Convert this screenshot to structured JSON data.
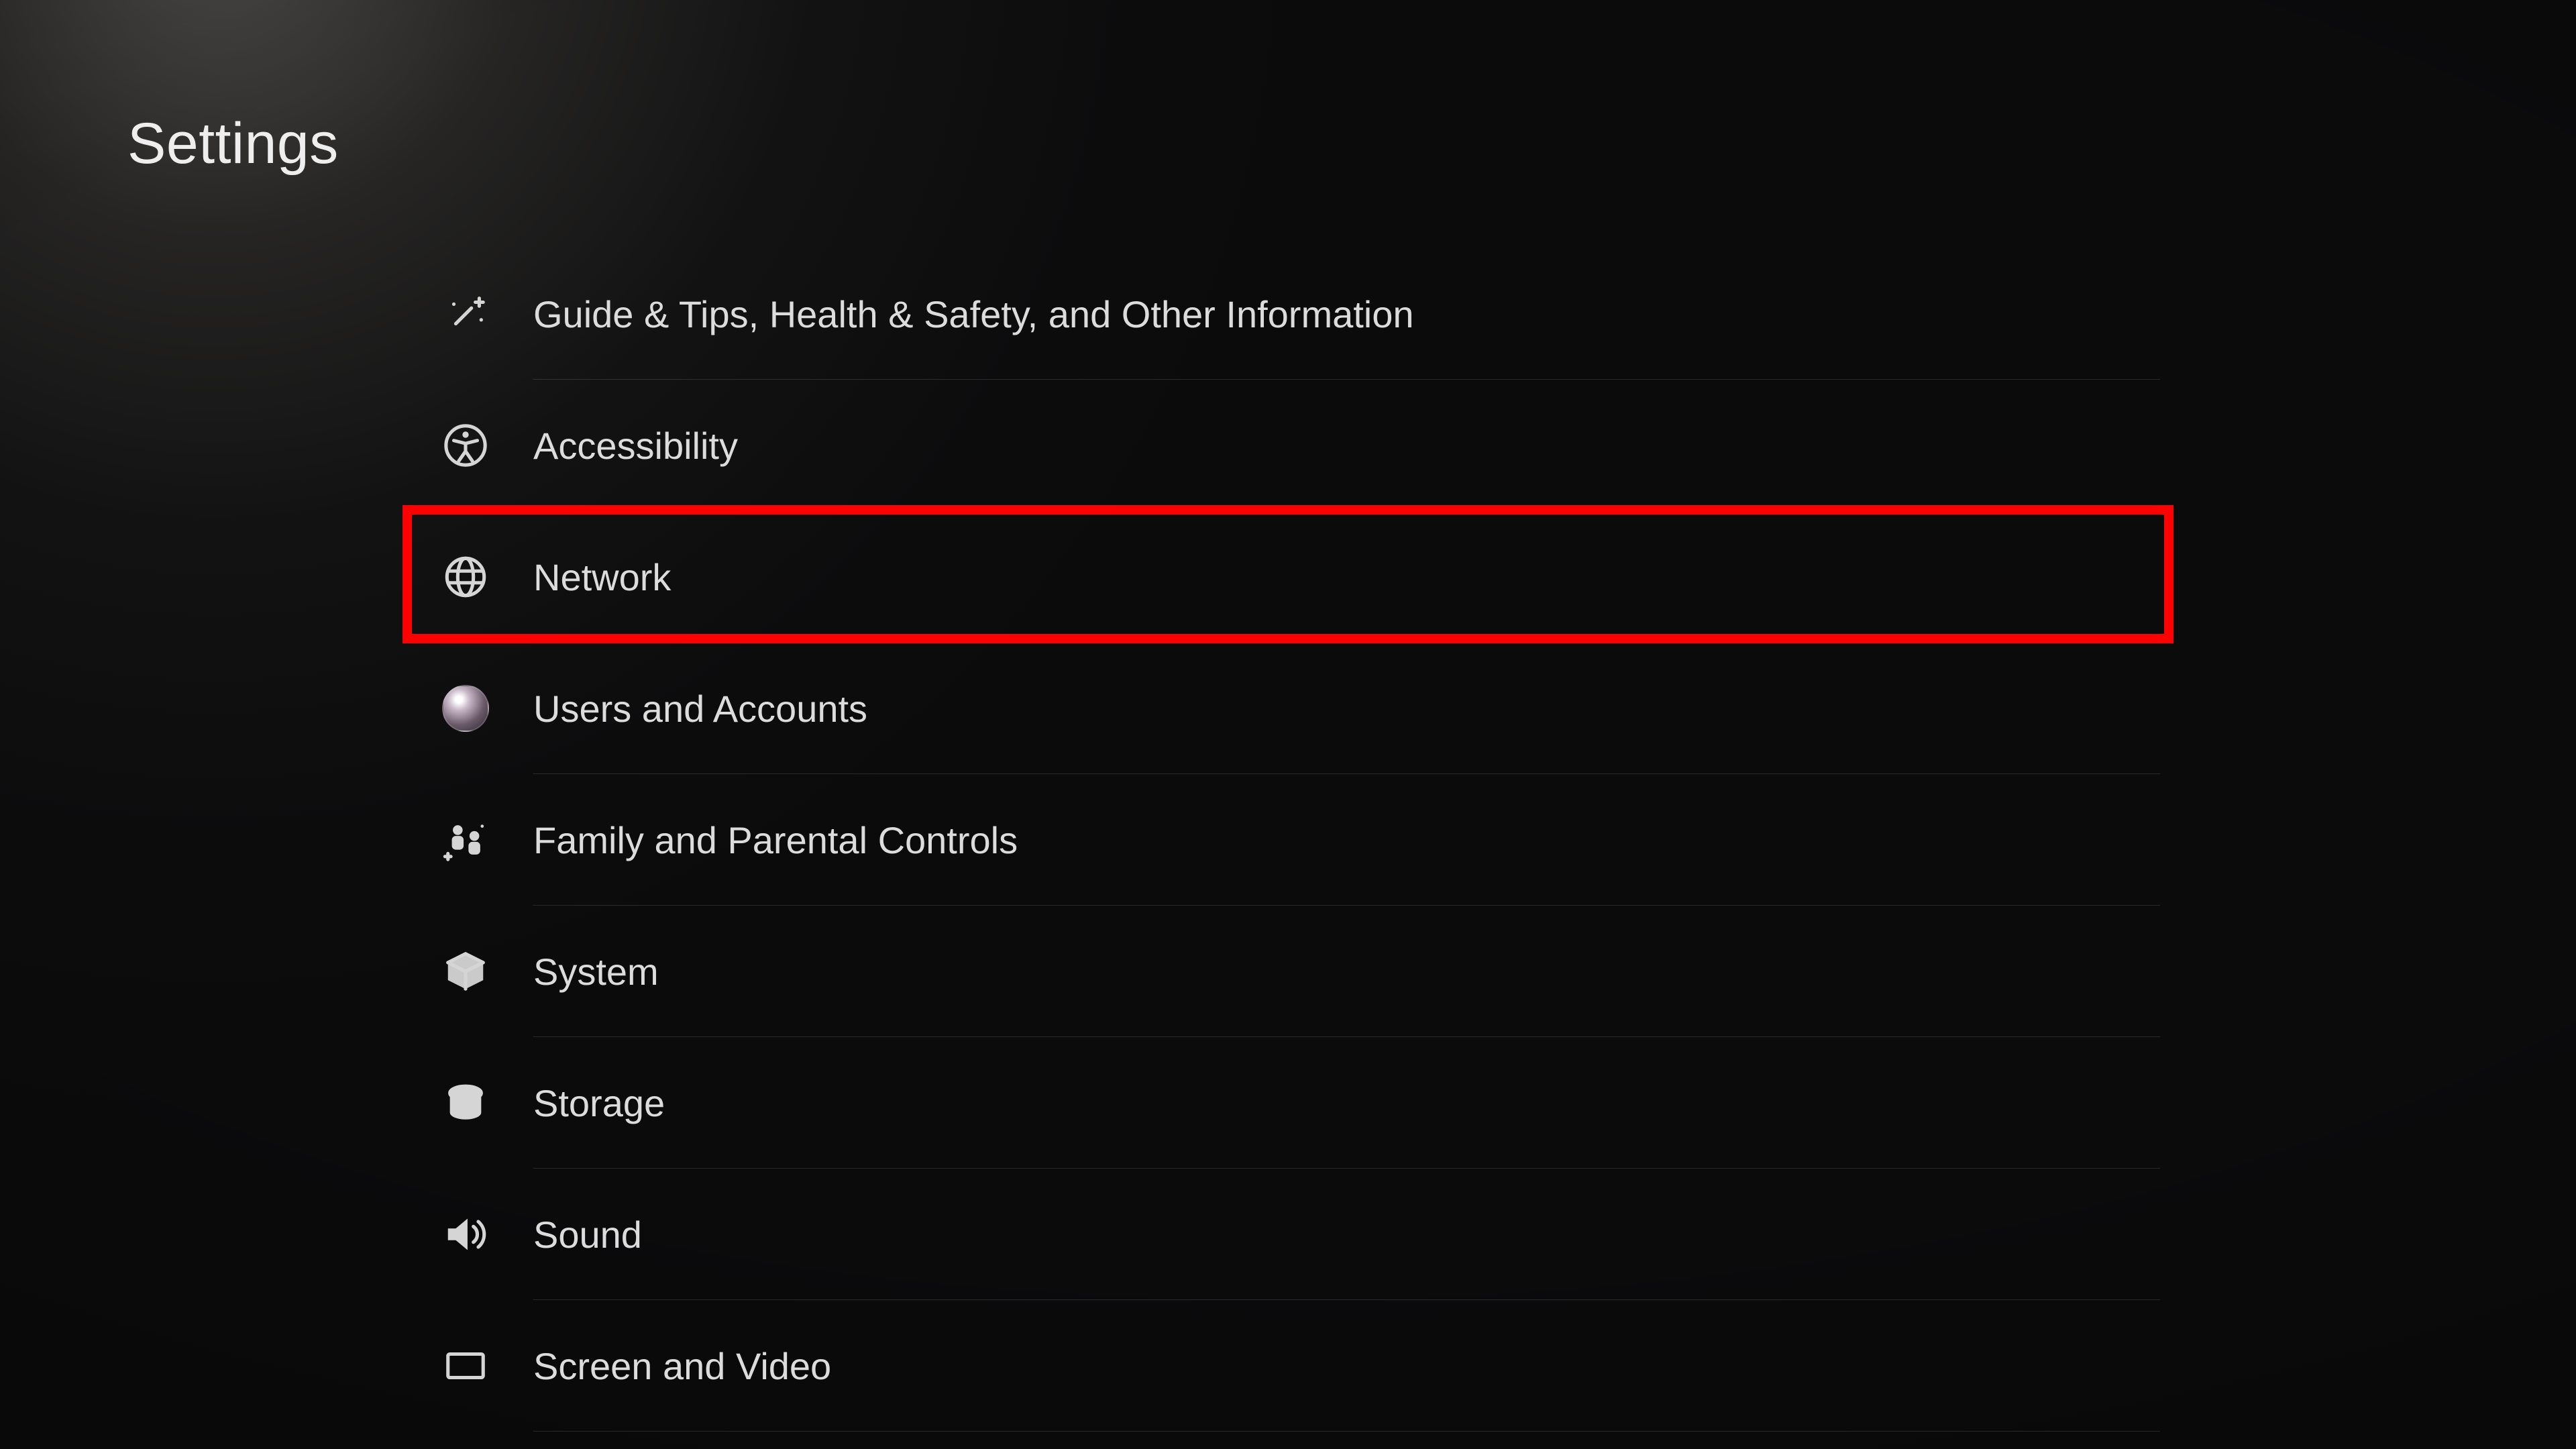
{
  "page": {
    "title": "Settings"
  },
  "menu": {
    "items": [
      {
        "id": "guide-tips",
        "label": "Guide & Tips, Health & Safety, and Other Information",
        "icon": "sparkle-wand-icon",
        "highlighted": false
      },
      {
        "id": "accessibility",
        "label": "Accessibility",
        "icon": "accessibility-icon",
        "highlighted": false
      },
      {
        "id": "network",
        "label": "Network",
        "icon": "globe-icon",
        "highlighted": true
      },
      {
        "id": "users",
        "label": "Users and Accounts",
        "icon": "avatar-icon",
        "highlighted": false
      },
      {
        "id": "family",
        "label": "Family and Parental Controls",
        "icon": "family-icon",
        "highlighted": false
      },
      {
        "id": "system",
        "label": "System",
        "icon": "cube-icon",
        "highlighted": false
      },
      {
        "id": "storage",
        "label": "Storage",
        "icon": "storage-icon",
        "highlighted": false
      },
      {
        "id": "sound",
        "label": "Sound",
        "icon": "speaker-icon",
        "highlighted": false
      },
      {
        "id": "screen",
        "label": "Screen and Video",
        "icon": "screen-icon",
        "highlighted": false
      }
    ]
  },
  "highlight": {
    "color": "#ff0000"
  }
}
